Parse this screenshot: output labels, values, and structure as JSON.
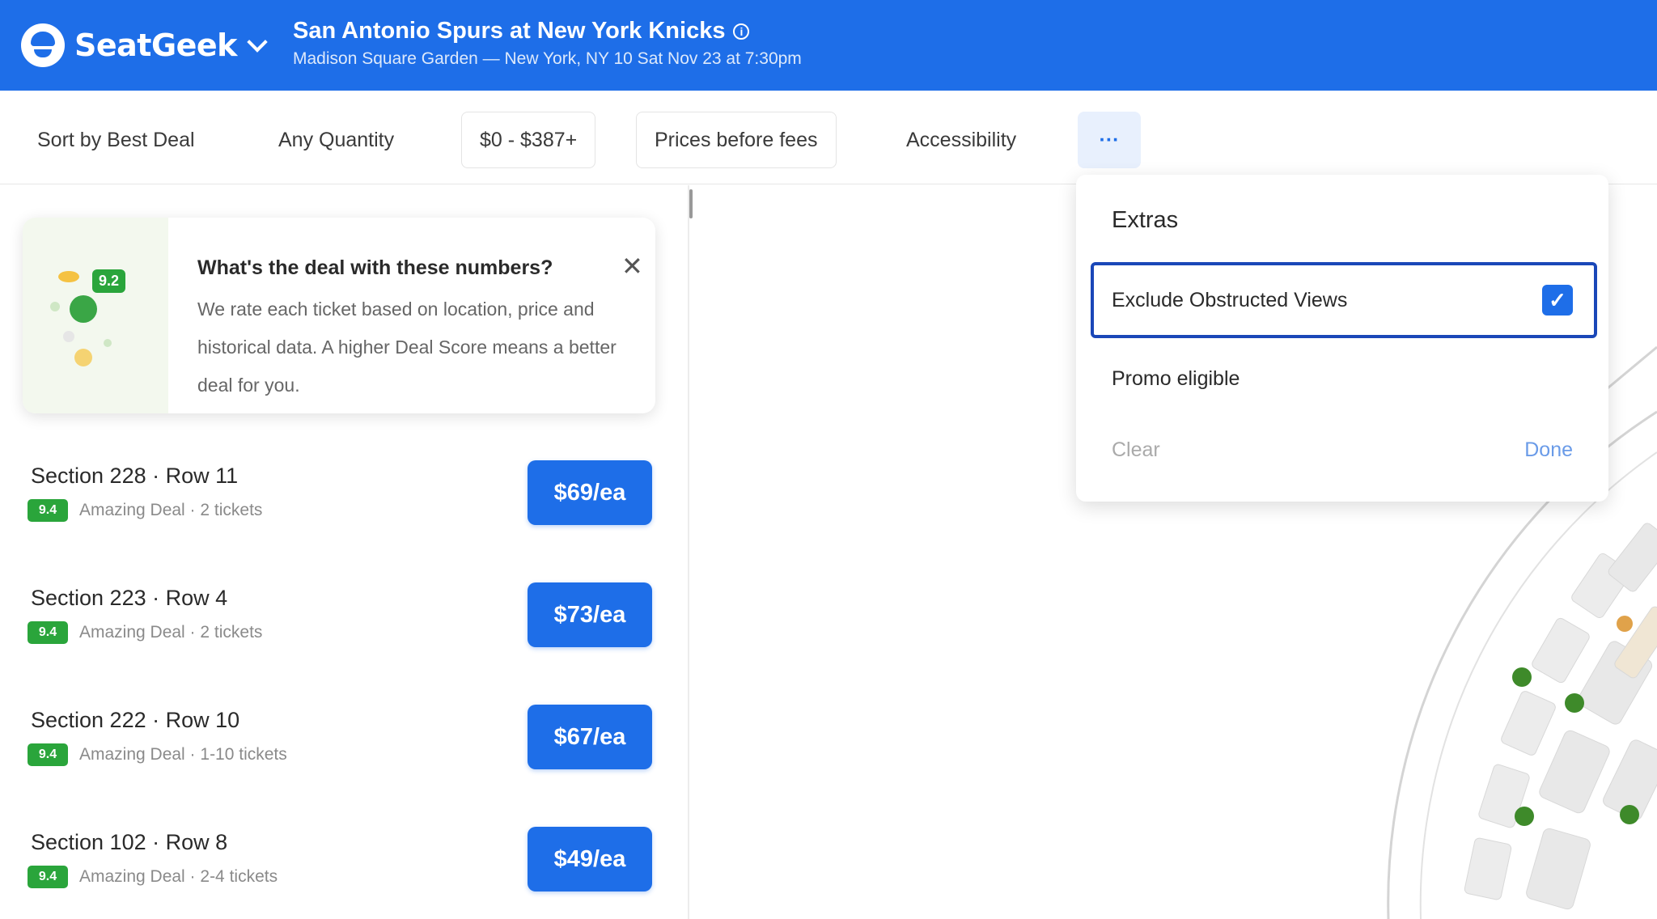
{
  "header": {
    "brand": "SeatGeek",
    "event_title": "San Antonio Spurs at New York Knicks",
    "event_subtitle": "Madison Square Garden — New York, NY 10 Sat Nov 23 at 7:30pm"
  },
  "filters": {
    "sort": "Sort by Best Deal",
    "quantity": "Any Quantity",
    "price": "$0 - $387+",
    "fees": "Prices before fees",
    "accessibility": "Accessibility",
    "more": "···"
  },
  "info_card": {
    "title": "What's the deal with these numbers?",
    "body": "We rate each ticket based on location, price and historical data. A higher Deal Score means a better deal for you.",
    "badge": "9.2",
    "close": "✕"
  },
  "listings": [
    {
      "title": "Section 228 · Row 11",
      "score": "9.4",
      "meta": "Amazing Deal · 2 tickets",
      "price": "$69/ea"
    },
    {
      "title": "Section 223 · Row 4",
      "score": "9.4",
      "meta": "Amazing Deal · 2 tickets",
      "price": "$73/ea"
    },
    {
      "title": "Section 222 · Row 10",
      "score": "9.4",
      "meta": "Amazing Deal · 1-10 tickets",
      "price": "$67/ea"
    },
    {
      "title": "Section 102 · Row 8",
      "score": "9.4",
      "meta": "Amazing Deal · 2-4 tickets",
      "price": "$49/ea"
    }
  ],
  "dropdown": {
    "heading": "Extras",
    "option_checked": "Exclude Obstructed Views",
    "option_2": "Promo eligible",
    "clear": "Clear",
    "done": "Done"
  },
  "colors": {
    "brand_blue": "#1e6ee8",
    "deal_green": "#2aa53b"
  }
}
